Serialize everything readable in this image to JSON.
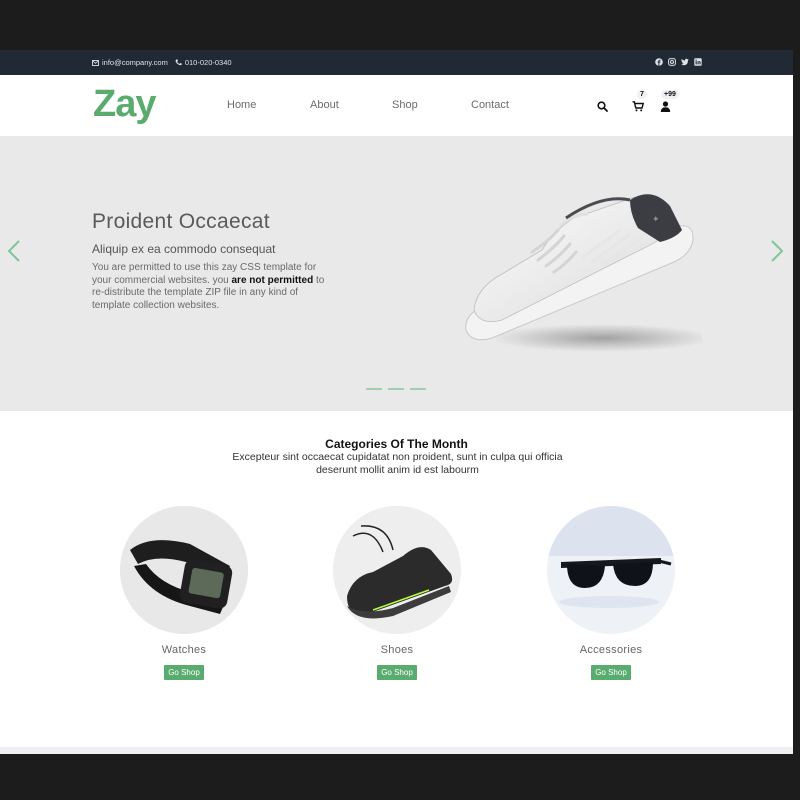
{
  "topbar": {
    "email": "info@company.com",
    "phone": "010-020-0340",
    "social_icons": [
      "facebook-icon",
      "instagram-icon",
      "twitter-icon",
      "linkedin-icon"
    ]
  },
  "nav": {
    "logo": "Zay",
    "menu": [
      "Home",
      "About",
      "Shop",
      "Contact"
    ],
    "cart_count": "7",
    "user_count": "+99"
  },
  "hero": {
    "title": "Proident Occaecat",
    "subtitle": "Aliquip ex ea commodo consequat",
    "text_before": "You are permitted to use this zay CSS template for your commercial websites. you ",
    "text_bold": "are not permitted",
    "text_after": " to re-distribute the template ZIP file in any kind of template collection websites.",
    "slide_count": 3
  },
  "categories": {
    "title": "Categories Of The Month",
    "description": "Excepteur sint occaecat cupidatat non proident, sunt in culpa qui officia deserunt mollit anim id est labourm",
    "items": [
      {
        "label": "Watches",
        "button": "Go Shop"
      },
      {
        "label": "Shoes",
        "button": "Go Shop"
      },
      {
        "label": "Accessories",
        "button": "Go Shop"
      }
    ]
  },
  "colors": {
    "brand": "#59ab6e",
    "topbar": "#212934",
    "hero_bg": "#e9e9e9"
  }
}
